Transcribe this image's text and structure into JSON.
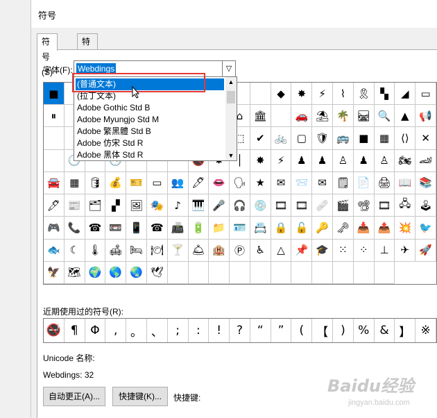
{
  "dialog": {
    "title": "符号"
  },
  "tabs": [
    {
      "label": "符号(S)",
      "active": true
    },
    {
      "label": "特殊字符(P)",
      "active": false
    }
  ],
  "font": {
    "label": "字体(F):",
    "value": "Webdings",
    "dropdown_options": [
      "(普通文本)",
      "(拉丁文本)",
      "Adobe Gothic Std B",
      "Adobe Myungjo Std M",
      "Adobe 繁黑體 Std B",
      "Adobe 仿宋 Std R",
      "Adobe 黑体 Std R"
    ],
    "highlighted_option": "(普通文本)"
  },
  "symbols": [
    "■",
    "",
    "",
    "",
    "",
    "",
    "",
    "",
    "",
    "",
    "",
    "◆",
    "✸",
    "⚡",
    "⌇",
    "🎗",
    "▚",
    "◢",
    "▭",
    "⏸",
    "",
    "",
    "",
    "",
    "",
    "",
    "",
    "⚓",
    "⌂",
    "🏛",
    "",
    "🚗",
    "⛱",
    "🌴",
    "🛤",
    "🔍",
    "▲",
    "📢",
    "",
    "",
    "",
    "",
    "",
    "",
    "",
    "",
    "🗨",
    "⬚",
    "✔",
    "🚲",
    "▢",
    "🛡",
    "🚌",
    "■",
    "▦",
    "⟨⟩",
    "✕",
    "",
    "🕑",
    "",
    "🕓",
    "",
    "",
    "",
    "🚭",
    "✸",
    "│",
    "✸",
    "⚡",
    "♟",
    "♟",
    "♙",
    "♟",
    "♙",
    "🏍",
    "🏎",
    "🚘",
    "▦",
    "🛢",
    "💰",
    "🎫",
    "▭",
    "👥",
    "🖊",
    "👄",
    "🗣",
    "★",
    "✉",
    "📨",
    "✉",
    "🗒",
    "📄",
    "🖨",
    "📖",
    "📚",
    "🖊",
    "📰",
    "🗂",
    "▞",
    "🖼",
    "🎭",
    "♪",
    "🎹",
    "🎤",
    "🎧",
    "💿",
    "🎞",
    "🎞",
    "🩹",
    "🎬",
    "📽",
    "🎞",
    "🖧",
    "🕹",
    "🎮",
    "📞",
    "☎",
    "📼",
    "📱",
    "☎",
    "📠",
    "🔋",
    "📁",
    "🪪",
    "📇",
    "🔒",
    "🔓",
    "🔑",
    "🗝",
    "📥",
    "📤",
    "💥",
    "🐦",
    "🐟",
    "☾",
    "🌡",
    "🛋",
    "🛏",
    "🍽",
    "🍸",
    "🛎",
    "🏨",
    "Ⓟ",
    "♿",
    "△",
    "📌",
    "🎓",
    "⁙",
    "⁘",
    "⊥",
    "✈",
    "🚀",
    "🦅",
    "🗺",
    "🌍",
    "🌎",
    "🌏",
    "🕊",
    "",
    "",
    "",
    "",
    "",
    "",
    "",
    "",
    "",
    "",
    ""
  ],
  "recent": {
    "label": "近期使用过的符号(R):",
    "symbols": [
      "🚭",
      "¶",
      "Φ",
      ",",
      "。",
      "、",
      ";",
      ":",
      "!",
      "?",
      "“",
      "”",
      "(",
      "【",
      ")",
      "%",
      "&",
      "】",
      "※"
    ]
  },
  "unicode_name_label": "Unicode 名称:",
  "code_text": "Webdings: 32",
  "buttons": {
    "autocorrect": "自动更正(A)...",
    "shortcut_key": "快捷键(K)..."
  },
  "shortcut_label": "快捷键:",
  "watermark": {
    "main": "Baidu经验",
    "sub": "jingyan.baidu.com"
  }
}
